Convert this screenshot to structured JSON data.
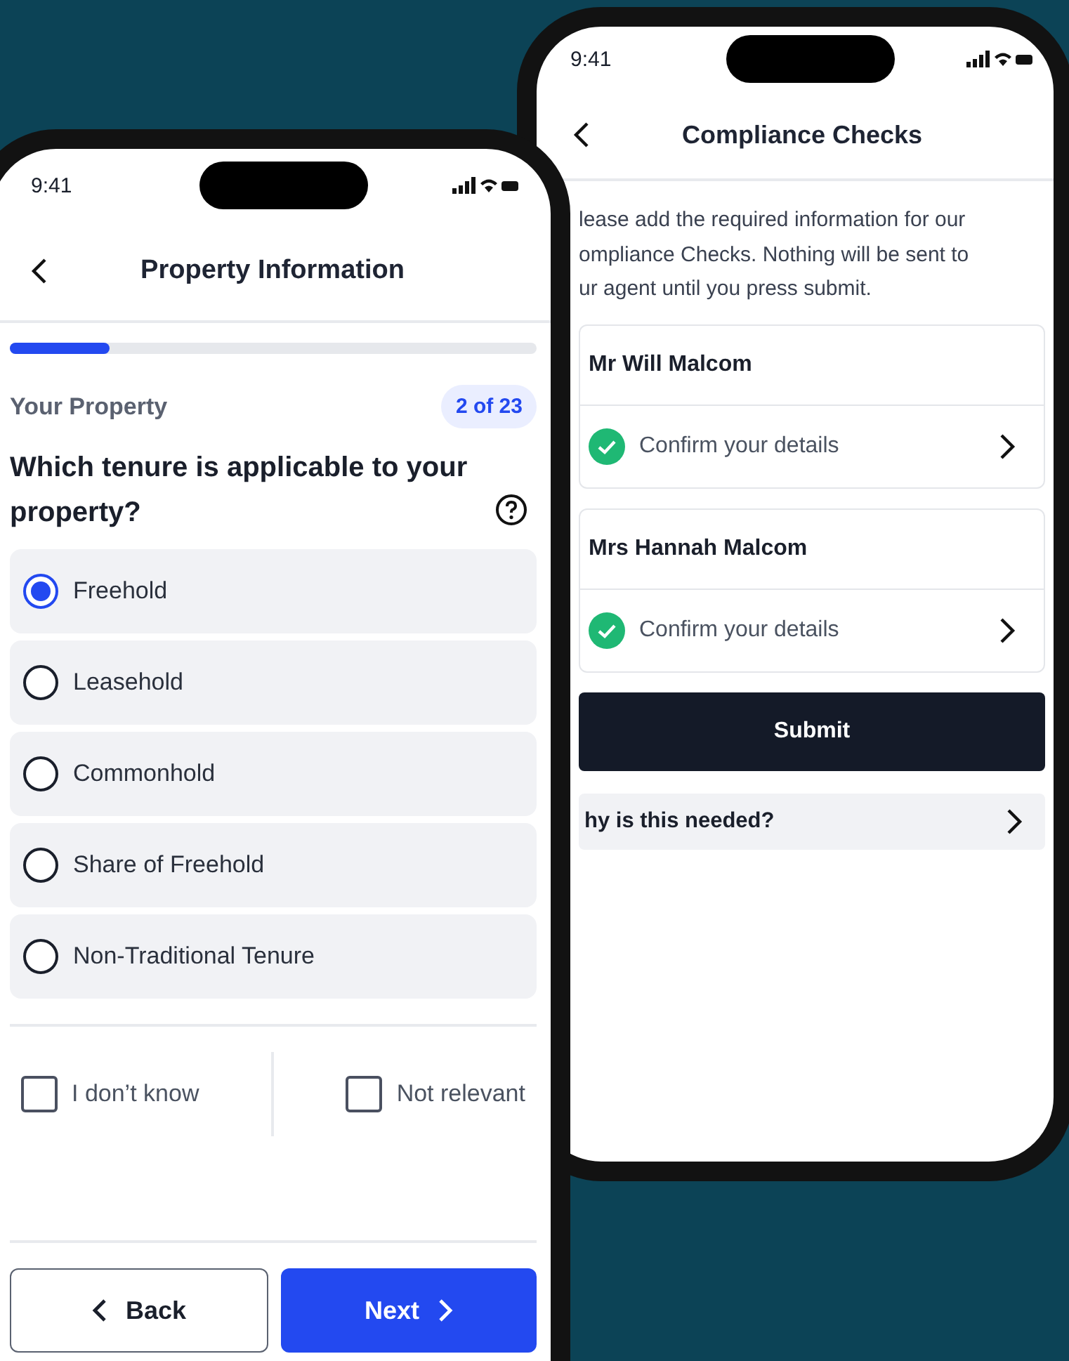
{
  "compliance_screen": {
    "status_time": "9:41",
    "title": "Compliance Checks",
    "intro_lines": [
      "lease add the required information for our",
      "ompliance Checks. Nothing will be sent to",
      "ur agent until you press submit."
    ],
    "people": [
      {
        "name": "Mr Will Malcom",
        "task": "Confirm your details",
        "done": true
      },
      {
        "name": "Mrs Hannah Malcom",
        "task": "Confirm your details",
        "done": true
      }
    ],
    "submit": "Submit",
    "help_link": "hy is this needed?"
  },
  "property_screen": {
    "status_time": "9:41",
    "title": "Property Information",
    "progress": {
      "level": 0.19
    },
    "section": "Your Property",
    "step_badge": "2 of 23",
    "question": "Which tenure is applicable to your property?",
    "options": [
      {
        "label": "Freehold",
        "selected": true
      },
      {
        "label": "Leasehold",
        "selected": false
      },
      {
        "label": "Commonhold",
        "selected": false
      },
      {
        "label": "Share of Freehold",
        "selected": false
      },
      {
        "label": "Non-Traditional Tenure",
        "selected": false
      }
    ],
    "extra_options": [
      {
        "label": "I don’t know",
        "checked": false
      },
      {
        "label": "Not relevant",
        "checked": false
      }
    ],
    "buttons": [
      {
        "kind": "secondary",
        "label": "Back"
      },
      {
        "kind": "primary",
        "label": "Next"
      }
    ]
  }
}
